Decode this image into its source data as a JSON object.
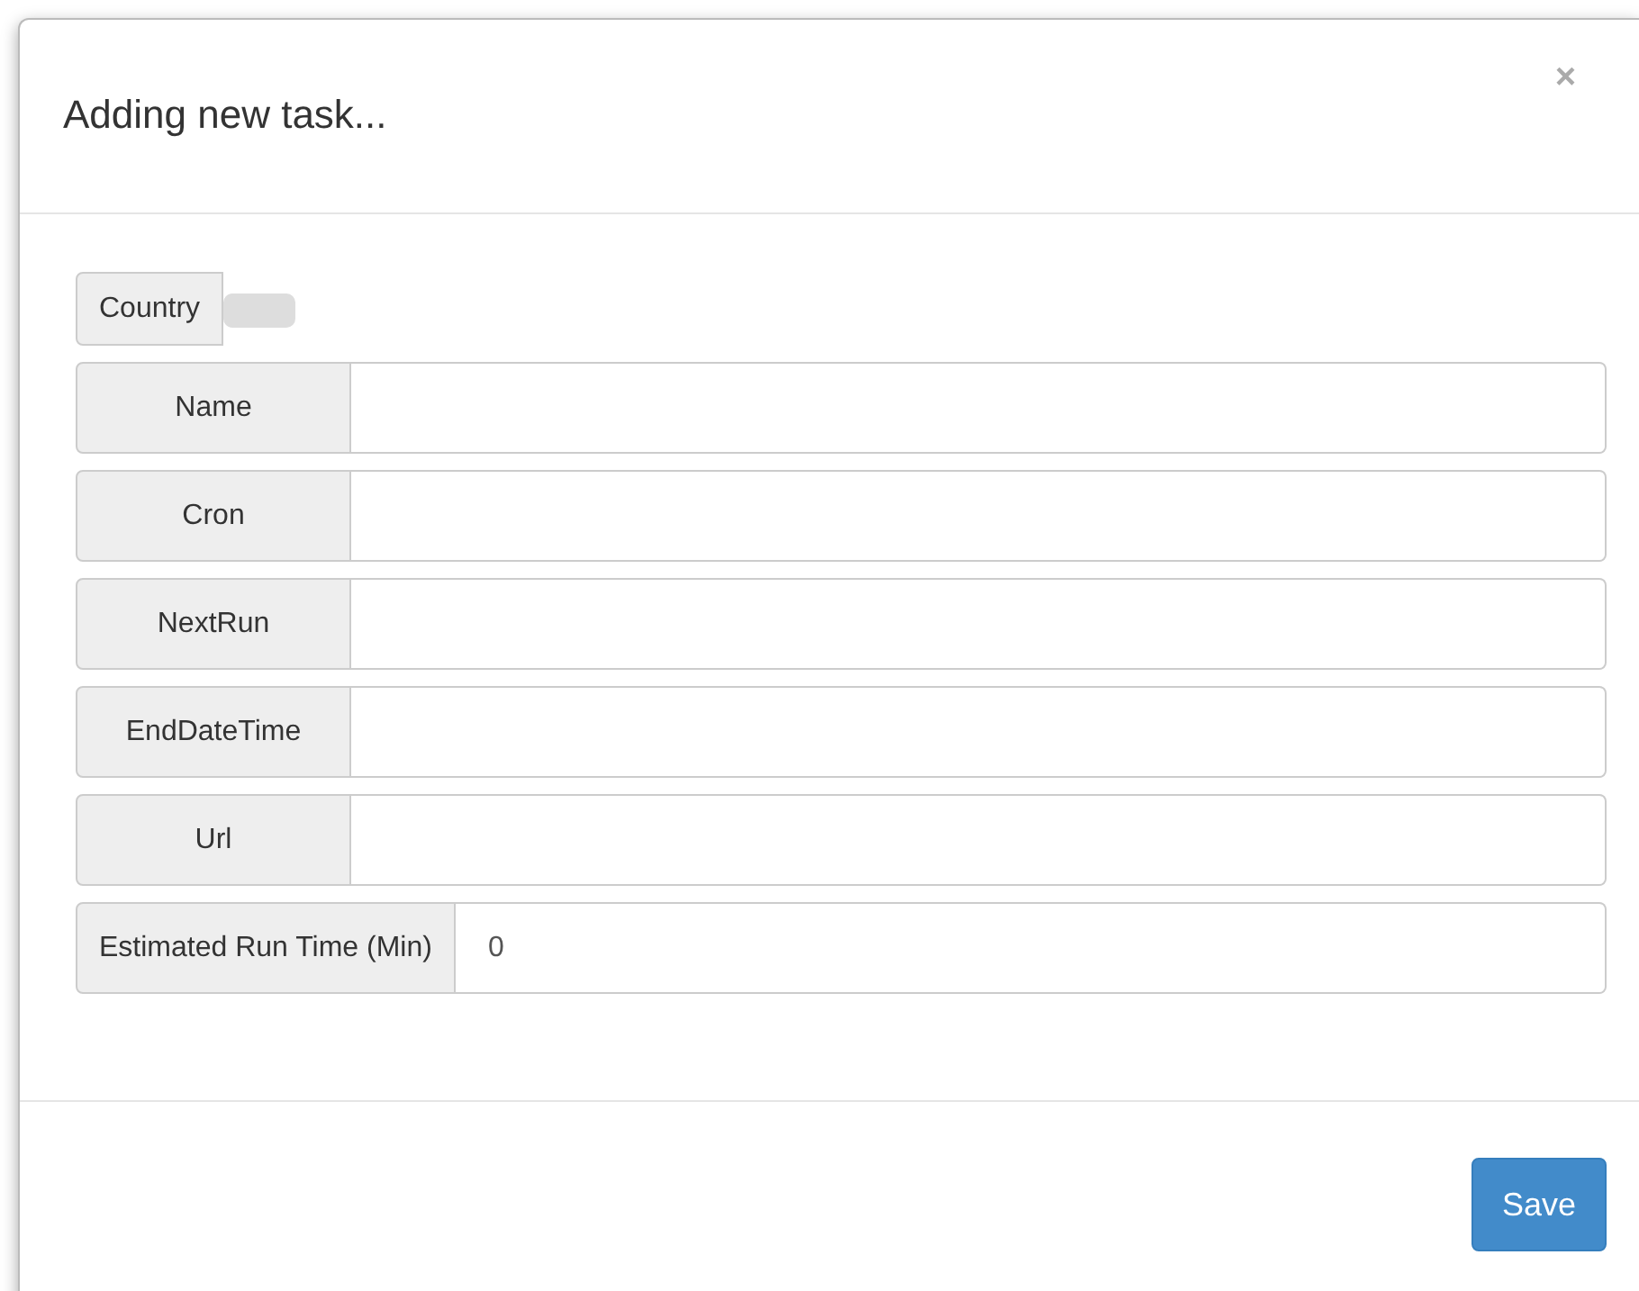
{
  "modal": {
    "title": "Adding new task...",
    "close": "×"
  },
  "fields": [
    {
      "kind": "select",
      "label": "Country"
    },
    {
      "kind": "text",
      "label": "Name"
    },
    {
      "kind": "text",
      "label": "Cron"
    },
    {
      "kind": "text",
      "label": "NextRun"
    },
    {
      "kind": "text",
      "label": "EndDateTime"
    },
    {
      "kind": "text",
      "label": "Url"
    },
    {
      "kind": "text",
      "label": "Estimated Run Time (Min)",
      "value": "0"
    }
  ],
  "buttons": [
    {
      "label": "Save"
    }
  ]
}
